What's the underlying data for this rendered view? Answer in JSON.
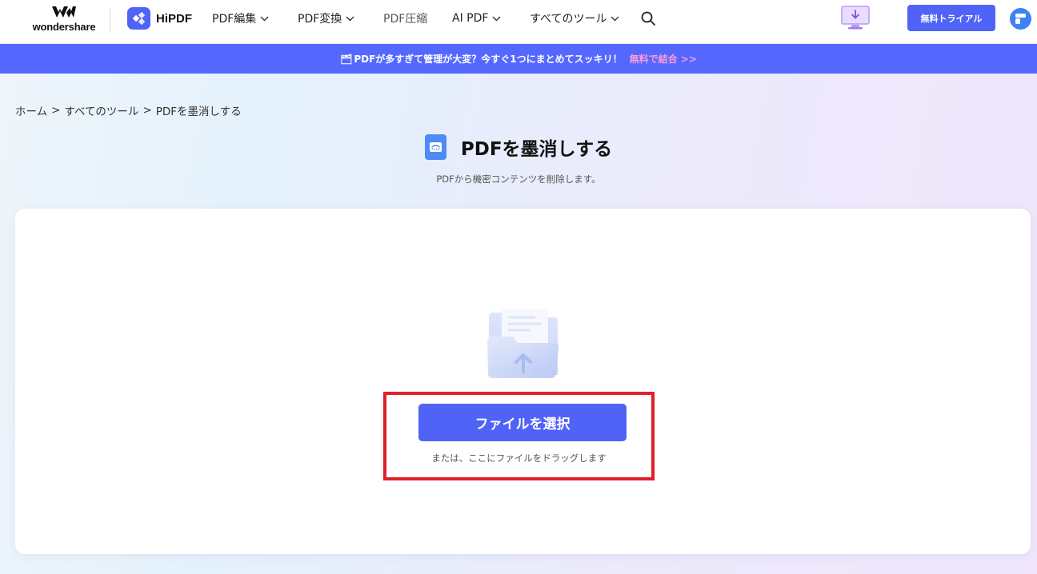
{
  "nav": {
    "brand": "wondershare",
    "product": "HiPDF",
    "items": [
      {
        "label": "PDF編集",
        "has_menu": true
      },
      {
        "label": "PDF変換",
        "has_menu": true
      },
      {
        "label": "PDF圧縮",
        "has_menu": false
      },
      {
        "label": "AI PDF",
        "has_menu": true
      },
      {
        "label": "すべてのツール",
        "has_menu": true
      }
    ],
    "search_icon": "search-icon",
    "download_icon": "desktop-download-icon",
    "trial_label": "無料トライアル",
    "avatar_icon": "user-avatar-icon"
  },
  "banner": {
    "emoji": "🗂",
    "text": "PDFが多すぎて管理が大変？今すぐ1つにまとめてスッキリ！",
    "cta": "無料で結合 >>"
  },
  "breadcrumb": {
    "items": [
      "ホーム",
      "すべてのツール",
      "PDFを墨消しする"
    ],
    "separator": ">"
  },
  "page": {
    "title": "PDFを墨消しする",
    "subtitle": "PDFから機密コンテンツを削除します。"
  },
  "upload": {
    "button_label": "ファイルを選択",
    "hint": "または、ここにファイルをドラッグします"
  },
  "colors": {
    "accent": "#4f63f7",
    "banner_bg": "#5468ff",
    "banner_cta": "#ff9bd9",
    "highlight": "#e0202a"
  }
}
